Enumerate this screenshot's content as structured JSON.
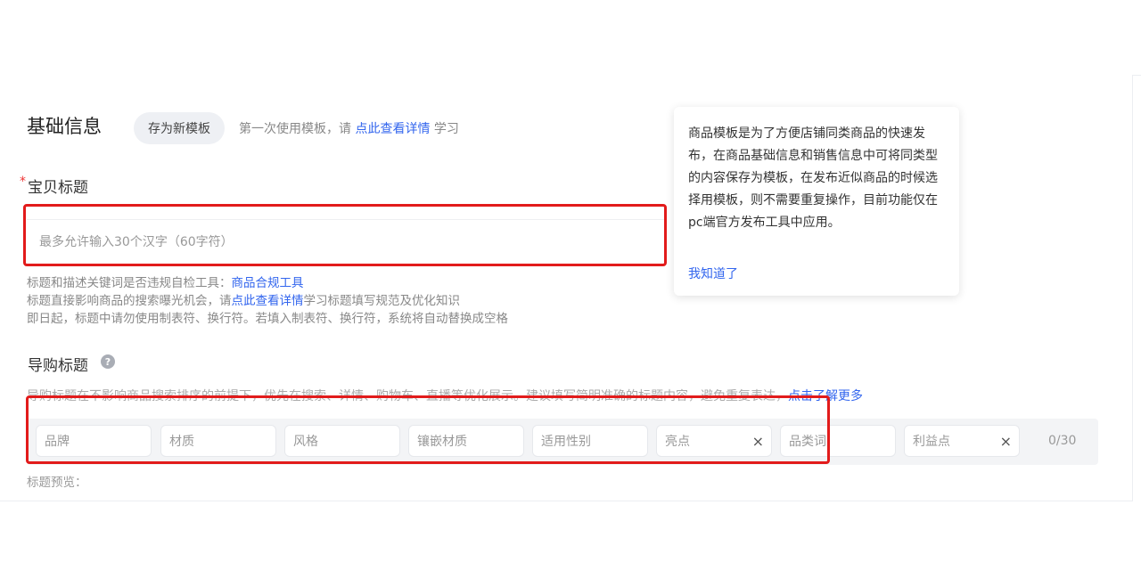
{
  "section_title": "基础信息",
  "save_template_label": "存为新模板",
  "template_hint": {
    "before": "第一次使用模板，请",
    "link": "点此查看详情",
    "after": "学习"
  },
  "title_field": {
    "required_mark": "*",
    "label": "宝贝标题",
    "placeholder": "最多允许输入30个汉字（60字符）",
    "value": ""
  },
  "help": {
    "line1_text": "标题和描述关键词是否违规自检工具：",
    "line1_link": "商品合规工具",
    "line2_before": "标题直接影响商品的搜索曝光机会，请",
    "line2_link": "点此查看详情",
    "line2_after": "学习标题填写规范及优化知识",
    "line3": "即日起，标题中请勿使用制表符、换行符。若填入制表符、换行符，系统将自动替换成空格"
  },
  "guide_title": {
    "label": "导购标题",
    "help_icon": "?",
    "description": "导购标题在不影响商品搜索排序的前提下，优先在搜索、详情、购物车、直播等优化展示。建议填写简明准确的标题内容，避免重复表达，",
    "description_link": "点击了解更多",
    "keywords": [
      {
        "placeholder": "品牌",
        "clearable": false
      },
      {
        "placeholder": "材质",
        "clearable": false
      },
      {
        "placeholder": "风格",
        "clearable": false
      },
      {
        "placeholder": "镶嵌材质",
        "clearable": false
      },
      {
        "placeholder": "适用性别",
        "clearable": false
      },
      {
        "placeholder": "亮点",
        "clearable": true
      },
      {
        "placeholder": "品类词",
        "clearable": false
      },
      {
        "placeholder": "利益点",
        "clearable": true
      }
    ],
    "clear_symbol": "×",
    "counter": "0/30",
    "preview_label": "标题预览："
  },
  "popover": {
    "text": "商品模板是为了方便店铺同类商品的快速发布，在商品基础信息和销售信息中可将同类型的内容保存为模板，在发布近似商品的时候选择用模板，则不需要重复操作，目前功能仅在pc端官方发布工具中应用。",
    "ok_link": "我知道了"
  },
  "colors": {
    "link": "#3366ee",
    "highlight_border": "#e21b1b",
    "required": "#e33333"
  }
}
